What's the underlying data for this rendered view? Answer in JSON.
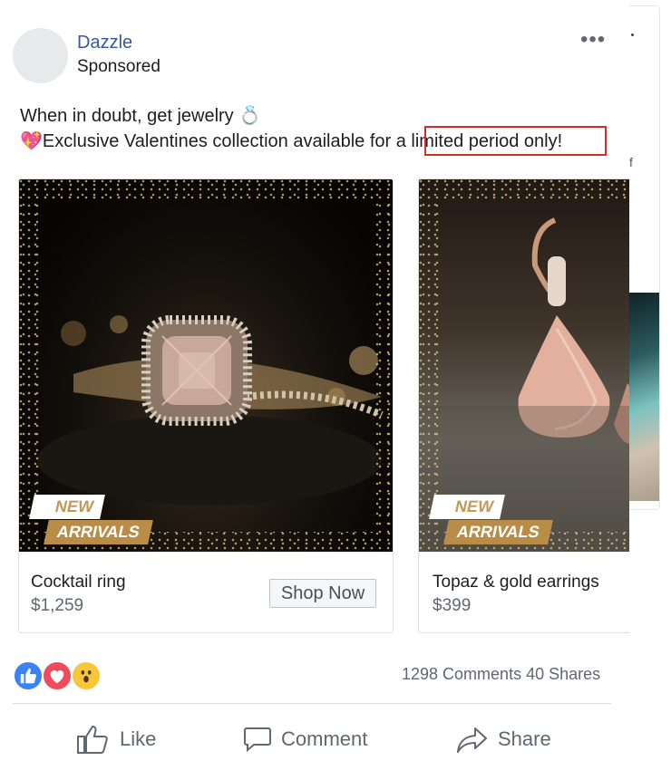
{
  "post": {
    "page_name": "Dazzle",
    "sponsored_label": "Sponsored",
    "more_label": "•••",
    "text_line1": "When in doubt, get jewelry",
    "text_line1_emoji": "💍",
    "text_line2_emoji": "💖",
    "text_line2": "Exclusive Valentines collection available for a limited period only!"
  },
  "carousel": {
    "cards": [
      {
        "title": "Cocktail ring",
        "price": "$1,259",
        "cta": "Shop Now",
        "badge_new": "NEW",
        "badge_arrivals": "ARRIVALS"
      },
      {
        "title": "Topaz & gold earrings",
        "price": "$399",
        "badge_new": "NEW",
        "badge_arrivals": "ARRIVALS"
      }
    ],
    "next_card_fragment": "f"
  },
  "reactions": {
    "icons": [
      "like-reaction-icon",
      "love-reaction-icon",
      "wow-reaction-icon"
    ],
    "comments": "1298 Comments",
    "shares": "40 Shares"
  },
  "actions": {
    "like": "Like",
    "comment": "Comment",
    "share": "Share"
  },
  "colors": {
    "link": "#385898",
    "highlight": "#d62c2c",
    "like_blue": "#3b82f6",
    "love_red": "#ef4b5c",
    "wow_yellow": "#f7c63a"
  }
}
